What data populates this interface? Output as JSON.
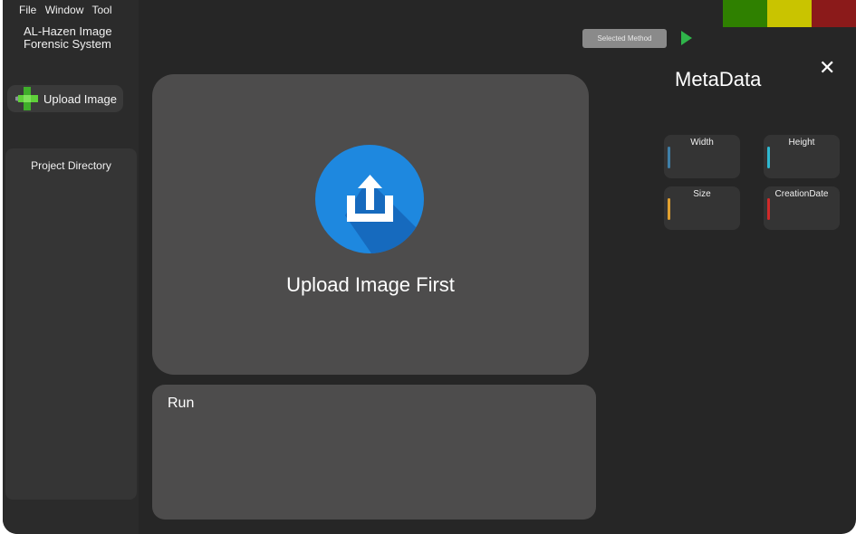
{
  "menu": {
    "file": "File",
    "window": "Window",
    "tool": "Tool"
  },
  "app": {
    "title_line1": "AL-Hazen Image",
    "title_line2": "Forensic System"
  },
  "sidebar": {
    "upload_label": "Upload Image",
    "project_directory": "Project Directory"
  },
  "toolbar": {
    "method_label": "Selected Method"
  },
  "status_colors": [
    "#2f8000",
    "#c9c400",
    "#8b1a1a"
  ],
  "main": {
    "upload_prompt": "Upload Image First",
    "run_label": "Run"
  },
  "metadata": {
    "title": "MetaData",
    "fields": [
      {
        "label": "Width",
        "accent": "#3f7fa8"
      },
      {
        "label": "Height",
        "accent": "#2fb8d0"
      },
      {
        "label": "Size",
        "accent": "#e0a030"
      },
      {
        "label": "CreationDate",
        "accent": "#d02a2a"
      }
    ]
  },
  "icons": {
    "upload": "upload-icon",
    "add": "plus-icon",
    "play": "play-icon",
    "close": "close-icon"
  }
}
